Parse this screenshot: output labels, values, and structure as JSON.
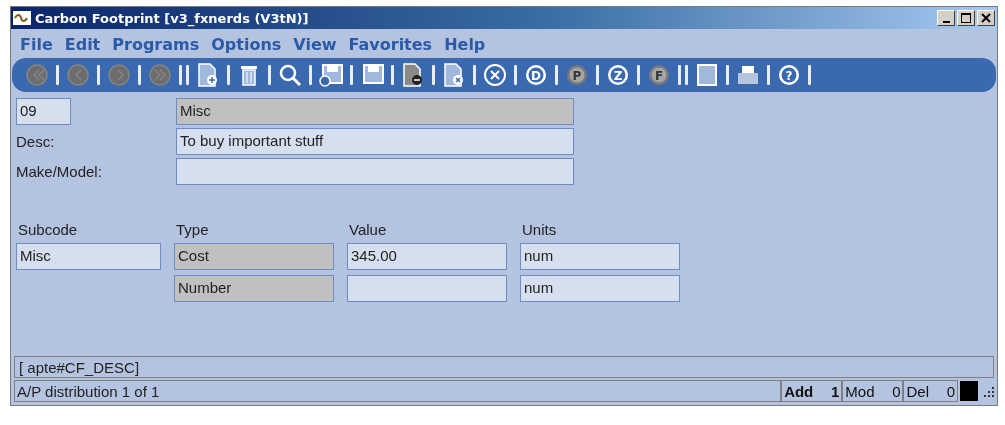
{
  "window": {
    "title": "Carbon Footprint [v3_fxnerds (V3tN)]"
  },
  "menu": [
    "File",
    "Edit",
    "Programs",
    "Options",
    "View",
    "Favorites",
    "Help"
  ],
  "toolbar": [
    {
      "kind": "first",
      "disabled": true
    },
    {
      "kind": "separator"
    },
    {
      "kind": "prev",
      "disabled": true
    },
    {
      "kind": "separator"
    },
    {
      "kind": "next",
      "disabled": true
    },
    {
      "kind": "separator"
    },
    {
      "kind": "last",
      "disabled": true
    },
    {
      "kind": "separator"
    },
    {
      "kind": "separator"
    },
    {
      "kind": "new",
      "disabled": false
    },
    {
      "kind": "separator"
    },
    {
      "kind": "delete",
      "disabled": false
    },
    {
      "kind": "separator"
    },
    {
      "kind": "search",
      "disabled": false
    },
    {
      "kind": "separator"
    },
    {
      "kind": "save-as",
      "disabled": false
    },
    {
      "kind": "separator"
    },
    {
      "kind": "save",
      "disabled": false
    },
    {
      "kind": "separator"
    },
    {
      "kind": "doc-minus",
      "disabled": false
    },
    {
      "kind": "separator"
    },
    {
      "kind": "doc-x",
      "disabled": false
    },
    {
      "kind": "separator"
    },
    {
      "kind": "cancel",
      "disabled": false
    },
    {
      "kind": "separator"
    },
    {
      "kind": "letter",
      "letter": "D",
      "disabled": false
    },
    {
      "kind": "separator"
    },
    {
      "kind": "letter",
      "letter": "P",
      "disabled": true
    },
    {
      "kind": "separator"
    },
    {
      "kind": "letter",
      "letter": "Z",
      "disabled": false
    },
    {
      "kind": "separator"
    },
    {
      "kind": "letter",
      "letter": "F",
      "disabled": true
    },
    {
      "kind": "separator"
    },
    {
      "kind": "separator"
    },
    {
      "kind": "page",
      "disabled": false
    },
    {
      "kind": "separator"
    },
    {
      "kind": "print",
      "disabled": false
    },
    {
      "kind": "separator"
    },
    {
      "kind": "letter",
      "letter": "?",
      "disabled": false
    },
    {
      "kind": "separator"
    }
  ],
  "header": {
    "code": "09",
    "name": "Misc",
    "desc_label": "Desc:",
    "desc": "To buy important stuff",
    "make_label": "Make/Model:"
  },
  "table": {
    "columns": [
      "Subcode",
      "Type",
      "Value",
      "Units"
    ],
    "rows": [
      {
        "subcode": "Misc",
        "type": "Cost",
        "value": "345.00",
        "units": "num"
      },
      {
        "type": "Number",
        "value": "",
        "units": "num"
      }
    ]
  },
  "message": "[ apte#CF_DESC]",
  "status_bar": {
    "text": "A/P distribution 1 of 1",
    "add_label": "Add",
    "add": "1",
    "mod_label": "Mod",
    "mod": "0",
    "del_label": "Del",
    "del": "0"
  }
}
